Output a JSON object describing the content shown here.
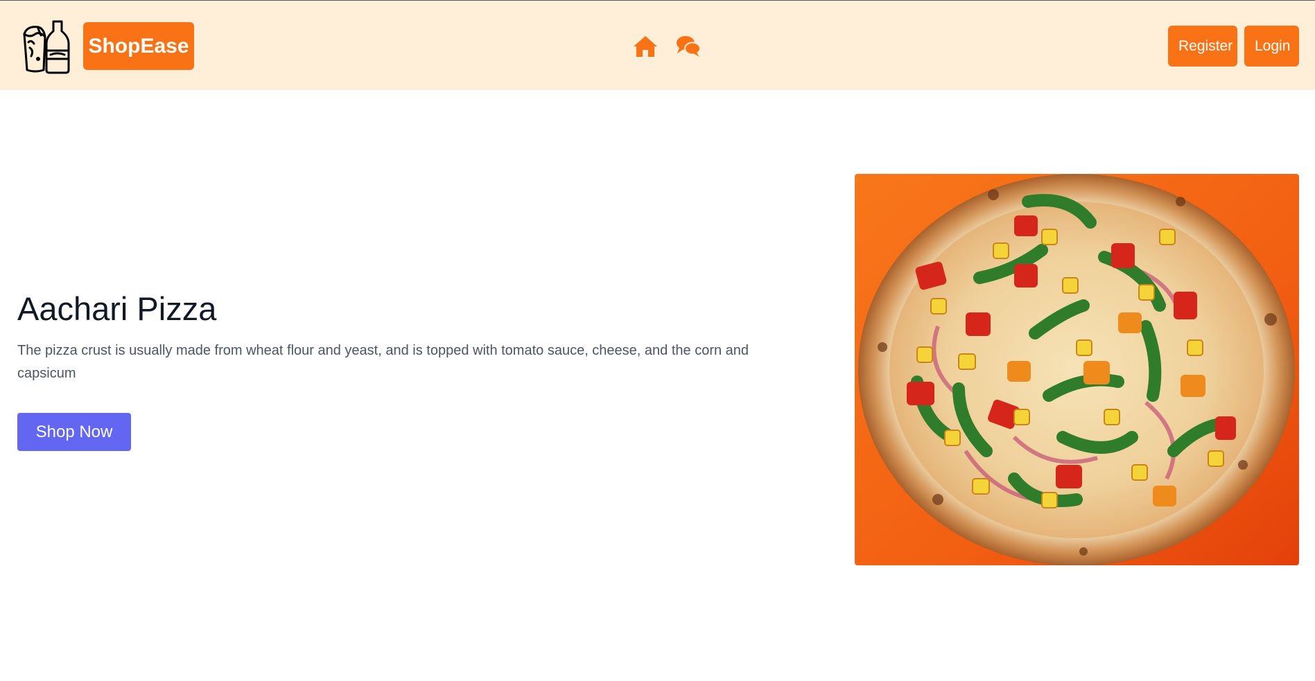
{
  "header": {
    "logo_icon": "wrap-and-bottle-icon",
    "brand": "ShopEase",
    "nav_icons": [
      "home-icon",
      "chat-icon"
    ],
    "register_label": "Register",
    "login_label": "Login"
  },
  "hero": {
    "title": "Aachari Pizza",
    "description": "The pizza crust is usually made from wheat flour and yeast, and is topped with tomato sauce, cheese, and the corn and capsicum",
    "cta_label": "Shop Now",
    "image": "pizza-image"
  },
  "colors": {
    "header_bg": "#ffeed8",
    "accent": "#f97316",
    "cta": "#6366f1",
    "title": "#111827",
    "body_text": "#4b5563"
  }
}
